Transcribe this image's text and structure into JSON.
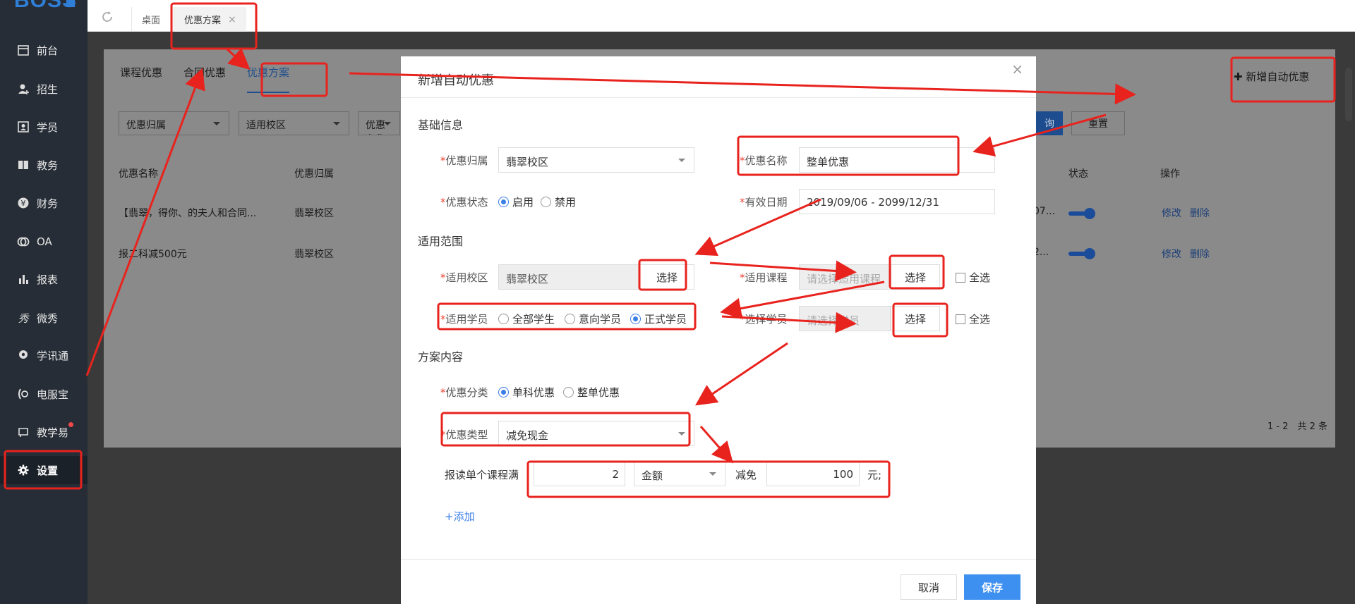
{
  "app": {
    "logo_text": "BOSS"
  },
  "sidebar": {
    "items": [
      {
        "label": "前台",
        "icon": "calendar-icon"
      },
      {
        "label": "招生",
        "icon": "user-add-icon"
      },
      {
        "label": "学员",
        "icon": "student-card-icon"
      },
      {
        "label": "教务",
        "icon": "book-icon"
      },
      {
        "label": "财务",
        "icon": "yen-icon"
      },
      {
        "label": "OA",
        "icon": "oa-icon"
      },
      {
        "label": "报表",
        "icon": "bar-chart-icon"
      },
      {
        "label": "微秀",
        "icon": "weixiu-icon"
      },
      {
        "label": "学讯通",
        "icon": "location-icon"
      },
      {
        "label": "电服宝",
        "icon": "phone-service-icon"
      },
      {
        "label": "教学易",
        "icon": "teach-icon"
      },
      {
        "label": "设置",
        "icon": "gear-icon"
      }
    ],
    "active": "设置"
  },
  "topbar": {
    "tabs": [
      {
        "label": "桌面"
      },
      {
        "label": "优惠方案",
        "close": "×"
      }
    ]
  },
  "page": {
    "subtabs": [
      "课程优惠",
      "合同优惠",
      "优惠方案"
    ],
    "filters": {
      "belong": "优惠归属",
      "campus": "适用校区",
      "name_partial": "优惠名称"
    },
    "buttons": {
      "search_partial": "询",
      "reset": "重置",
      "add_auto": "新增自动优惠"
    },
    "table": {
      "headers": {
        "name": "优惠名称",
        "belong": "优惠归属",
        "status": "状态",
        "ops": "操作"
      },
      "rows": [
        {
          "name": "【翡翠，得你、的夫人和合同...",
          "belong": "翡翠校区",
          "date_partial": "07...",
          "edit": "修改",
          "delete": "删除"
        },
        {
          "name": "报二科减500元",
          "belong": "翡翠校区",
          "date_partial": "2...",
          "edit": "修改",
          "delete": "删除"
        }
      ]
    },
    "pagination": "1 - 2　共 2 条"
  },
  "modal": {
    "title": "新增自动优惠",
    "close": "×",
    "sections": {
      "basic": "基础信息",
      "scope": "适用范围",
      "content": "方案内容"
    },
    "fields": {
      "belong_label": "优惠归属",
      "belong_value": "翡翠校区",
      "name_label": "优惠名称",
      "name_value": "整单优惠",
      "status_label": "优惠状态",
      "status_enabled": "启用",
      "status_disabled": "禁用",
      "date_label": "有效日期",
      "date_value": "2019/09/06 - 2099/12/31",
      "campus_label": "适用校区",
      "campus_value": "翡翠校区",
      "campus_btn": "选择",
      "course_label": "适用课程",
      "course_placeholder": "请选择适用课程",
      "course_btn": "选择",
      "course_all": "全选",
      "student_label": "适用学员",
      "student_all": "全部学生",
      "student_intent": "意向学员",
      "student_formal": "正式学员",
      "select_student_label": "选择学员",
      "select_student_placeholder": "请选择学员",
      "select_student_btn": "选择",
      "select_student_all": "全选",
      "category_label": "优惠分类",
      "category_single": "单科优惠",
      "category_whole": "整单优惠",
      "type_label": "优惠类型",
      "type_value": "减免现金",
      "rule_prefix": "报读单个课程满",
      "rule_count": "2",
      "rule_unit": "金额",
      "rule_reduce": "减免",
      "rule_amount": "100",
      "rule_suffix": "元;",
      "add_link": "+添加"
    },
    "footer": {
      "cancel": "取消",
      "save": "保存"
    }
  },
  "colors": {
    "annotation_red": "#e8231e",
    "primary_blue": "#3d8ff0",
    "sidebar_bg": "#262d36"
  }
}
